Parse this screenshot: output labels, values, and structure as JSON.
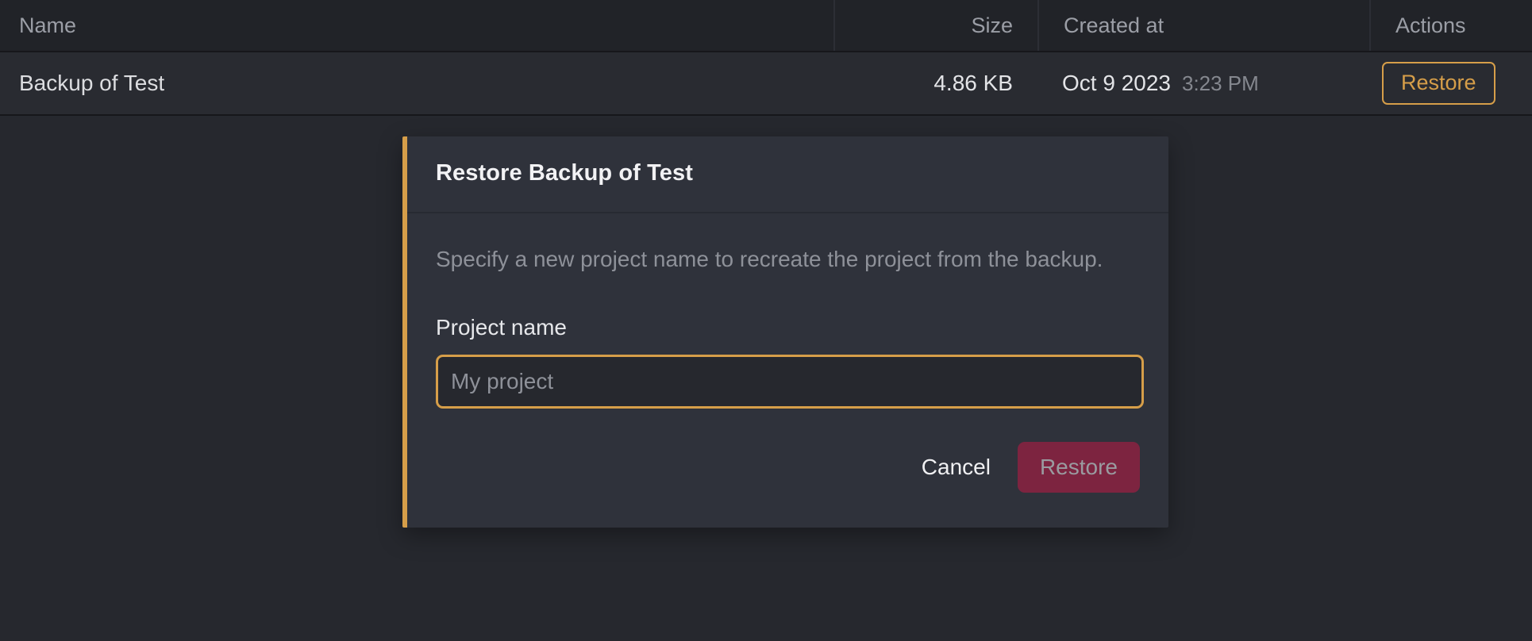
{
  "table": {
    "columns": [
      {
        "key": "name",
        "label": "Name"
      },
      {
        "key": "size",
        "label": "Size"
      },
      {
        "key": "created",
        "label": "Created at"
      },
      {
        "key": "actions",
        "label": "Actions"
      }
    ],
    "rows": [
      {
        "name": "Backup of Test",
        "size": "4.86 KB",
        "created_date": "Oct 9 2023",
        "created_time": "3:23 PM",
        "action_label": "Restore"
      }
    ]
  },
  "modal": {
    "title": "Restore Backup of Test",
    "description": "Specify a new project name to recreate the project from the backup.",
    "field": {
      "label": "Project name",
      "value": "",
      "placeholder": "My project"
    },
    "cancel_label": "Cancel",
    "confirm_label": "Restore"
  },
  "colors": {
    "accent": "#d69e49",
    "danger": "#7d2440",
    "page_bg": "#26282e",
    "modal_bg": "#2f323b"
  }
}
